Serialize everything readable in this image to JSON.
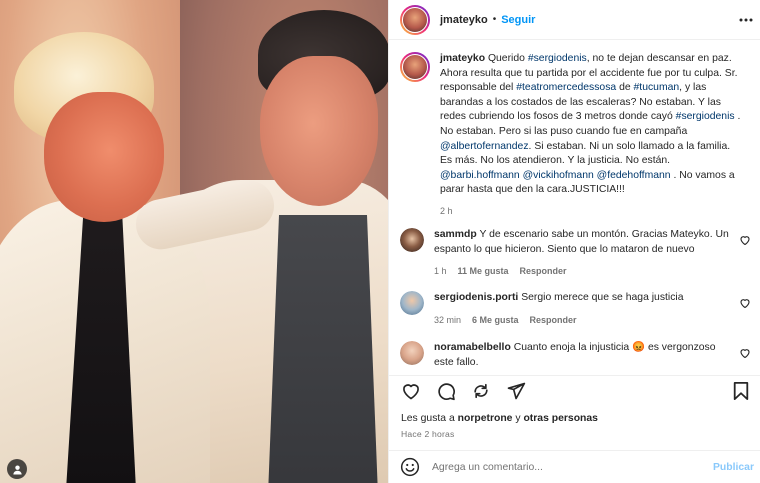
{
  "post": {
    "username": "jmateyko",
    "follow_label": "Seguir",
    "dot": "•"
  },
  "caption": {
    "username": "jmateyko",
    "parts": [
      {
        "t": " Querido ",
        "link": false
      },
      {
        "t": "#sergiodenis",
        "link": true
      },
      {
        "t": ", no te dejan descansar en paz. Ahora resulta que tu partida por el accidente fue por tu culpa. Sr. responsable del ",
        "link": false
      },
      {
        "t": "#teatromercedessosa",
        "link": true
      },
      {
        "t": " de ",
        "link": false
      },
      {
        "t": "#tucuman",
        "link": true
      },
      {
        "t": ", y las barandas a los costados de las escaleras? No estaban. Y las redes cubriendo los fosos de 3 metros donde cayó ",
        "link": false
      },
      {
        "t": "#sergiodenis",
        "link": true
      },
      {
        "t": " . No estaban. Pero si las puso cuando fue en campaña ",
        "link": false
      },
      {
        "t": "@albertofernandez",
        "link": true
      },
      {
        "t": ". Si estaban. Ni un solo llamado a la familia. Es más. No los atendieron. Y la justicia. No están. ",
        "link": false
      },
      {
        "t": "@barbi.hoffmann",
        "link": true
      },
      {
        "t": " ",
        "link": false
      },
      {
        "t": "@vickihofmann",
        "link": true
      },
      {
        "t": " ",
        "link": false
      },
      {
        "t": "@fedehoffmann",
        "link": true
      },
      {
        "t": " . No vamos a parar hasta que den la cara.JUSTICIA!!!",
        "link": false
      }
    ],
    "time": "2 h"
  },
  "comments": [
    {
      "username": "sammdp",
      "text": "Y de escenario sabe un montón. Gracias Mateyko. Un espanto lo que hicieron. Siento que lo mataron de nuevo",
      "time": "1 h",
      "likes": "11 Me gusta",
      "reply": "Responder"
    },
    {
      "username": "sergiodenis.porti",
      "text": "Sergio merece que se haga justicia",
      "time": "32 min",
      "likes": "6 Me gusta",
      "reply": "Responder"
    },
    {
      "username": "noramabelbello",
      "text_before": "Cuanto enoja la injusticia ",
      "emoji": "😡",
      "text_after": " es vergonzoso este fallo."
    }
  ],
  "likes_line": {
    "prefix": "Les gusta a ",
    "user": "norpetrone",
    "mid": " y ",
    "rest": "otras personas"
  },
  "posted_ago": "Hace 2 horas",
  "add_comment": {
    "placeholder": "Agrega un comentario...",
    "publish_label": "Publicar"
  },
  "colors": {
    "link": "#00376b",
    "follow": "#0095f6",
    "publish_disabled": "#8ac9fb",
    "muted": "#737373"
  }
}
